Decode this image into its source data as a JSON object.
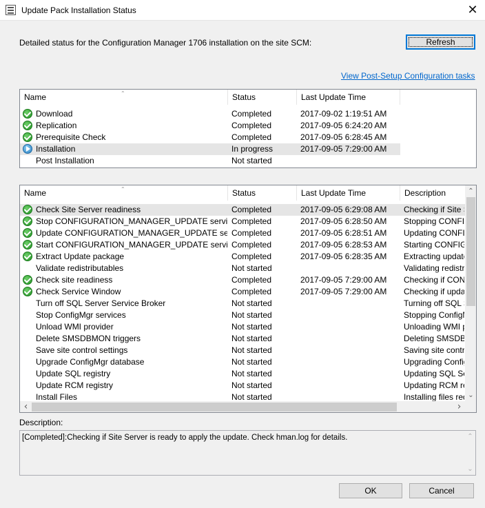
{
  "window": {
    "title": "Update Pack Installation Status",
    "close_glyph": "✕",
    "icon": "app-window-icon"
  },
  "intro_text": "Detailed status for the Configuration Manager 1706 installation on the site SCM:",
  "refresh_label": "Refresh",
  "post_setup_link": "View Post-Setup Configuration tasks",
  "top_list": {
    "columns": [
      "Name",
      "Status",
      "Last Update Time"
    ],
    "rows": [
      {
        "icon": "completed-check-icon",
        "name": "Download",
        "status": "Completed",
        "time": "2017-09-02 1:19:51 AM"
      },
      {
        "icon": "completed-check-icon",
        "name": "Replication",
        "status": "Completed",
        "time": "2017-09-05 6:24:20 AM"
      },
      {
        "icon": "completed-check-icon",
        "name": "Prerequisite Check",
        "status": "Completed",
        "time": "2017-09-05 6:28:45 AM"
      },
      {
        "icon": "in-progress-play-icon",
        "name": "Installation",
        "status": "In progress",
        "time": "2017-09-05 7:29:00 AM",
        "selected": true
      },
      {
        "icon": "",
        "name": "Post Installation",
        "status": "Not started",
        "time": ""
      }
    ]
  },
  "bottom_list": {
    "columns": [
      "Name",
      "Status",
      "Last Update Time",
      "Description"
    ],
    "rows": [
      {
        "icon": "completed-check-icon",
        "name": "Check Site Server readiness",
        "status": "Completed",
        "time": "2017-09-05 6:29:08 AM",
        "desc": "Checking if Site Se",
        "selected": true
      },
      {
        "icon": "completed-check-icon",
        "name": "Stop CONFIGURATION_MANAGER_UPDATE service",
        "status": "Completed",
        "time": "2017-09-05 6:28:50 AM",
        "desc": "Stopping CONFIGUR"
      },
      {
        "icon": "completed-check-icon",
        "name": "Update CONFIGURATION_MANAGER_UPDATE service",
        "status": "Completed",
        "time": "2017-09-05 6:28:51 AM",
        "desc": "Updating CONFIG"
      },
      {
        "icon": "completed-check-icon",
        "name": "Start CONFIGURATION_MANAGER_UPDATE service",
        "status": "Completed",
        "time": "2017-09-05 6:28:53 AM",
        "desc": "Starting CONFIGU"
      },
      {
        "icon": "completed-check-icon",
        "name": "Extract Update package",
        "status": "Completed",
        "time": "2017-09-05 6:28:35 AM",
        "desc": "Extracting update p"
      },
      {
        "icon": "",
        "name": "Validate redistributables",
        "status": "Not started",
        "time": "",
        "desc": "Validating redistribu"
      },
      {
        "icon": "completed-check-icon",
        "name": "Check site readiness",
        "status": "Completed",
        "time": "2017-09-05 7:29:00 AM",
        "desc": "Checking if CONFI"
      },
      {
        "icon": "completed-check-icon",
        "name": "Check Service Window",
        "status": "Completed",
        "time": "2017-09-05 7:29:00 AM",
        "desc": "Checking if update"
      },
      {
        "icon": "",
        "name": "Turn off SQL Server Service Broker",
        "status": "Not started",
        "time": "",
        "desc": "Turning off SQL Se"
      },
      {
        "icon": "",
        "name": "Stop ConfigMgr services",
        "status": "Not started",
        "time": "",
        "desc": "Stopping ConfigMgr"
      },
      {
        "icon": "",
        "name": "Unload WMI provider",
        "status": "Not started",
        "time": "",
        "desc": "Unloading WMI pro"
      },
      {
        "icon": "",
        "name": "Delete SMSDBMON triggers",
        "status": "Not started",
        "time": "",
        "desc": "Deleting SMSDBMO"
      },
      {
        "icon": "",
        "name": "Save site control settings",
        "status": "Not started",
        "time": "",
        "desc": "Saving site control"
      },
      {
        "icon": "",
        "name": "Upgrade ConfigMgr database",
        "status": "Not started",
        "time": "",
        "desc": "Upgrading ConfigM"
      },
      {
        "icon": "",
        "name": "Update SQL registry",
        "status": "Not started",
        "time": "",
        "desc": "Updating SQL Ser"
      },
      {
        "icon": "",
        "name": "Update RCM registry",
        "status": "Not started",
        "time": "",
        "desc": "Updating RCM reg"
      },
      {
        "icon": "",
        "name": "Install Files",
        "status": "Not started",
        "time": "",
        "desc": "Installing files requi"
      }
    ]
  },
  "description_label": "Description:",
  "description_text": "[Completed]:Checking if Site Server is ready to apply the update. Check hman.log for details.",
  "ok_label": "OK",
  "cancel_label": "Cancel",
  "glyphs": {
    "up": "⌃",
    "down": "⌄",
    "left": "‹",
    "right": "›"
  }
}
